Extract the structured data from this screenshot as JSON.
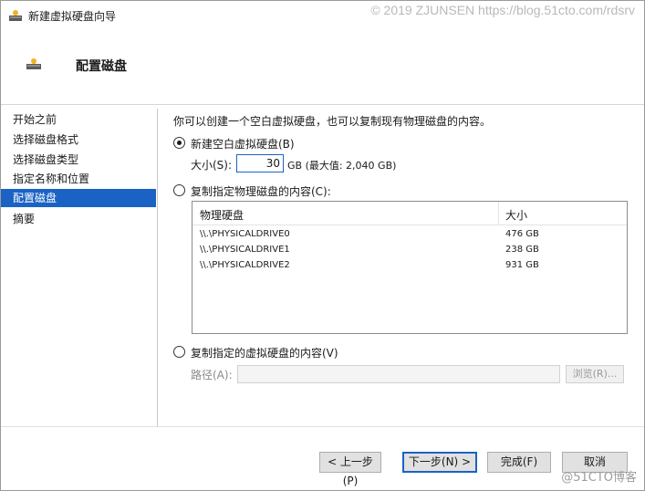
{
  "window": {
    "title": "新建虚拟硬盘向导",
    "watermark_top": "© 2019 ZJUNSEN https://blog.51cto.com/rdsrv",
    "watermark_bottom": "@51CTO博客"
  },
  "header": {
    "title": "配置磁盘"
  },
  "sidebar": {
    "items": [
      {
        "label": "开始之前",
        "active": false
      },
      {
        "label": "选择磁盘格式",
        "active": false
      },
      {
        "label": "选择磁盘类型",
        "active": false
      },
      {
        "label": "指定名称和位置",
        "active": false
      },
      {
        "label": "配置磁盘",
        "active": true
      },
      {
        "label": "摘要",
        "active": false
      }
    ]
  },
  "main": {
    "description": "你可以创建一个空白虚拟硬盘，也可以复制现有物理磁盘的内容。",
    "option_new": {
      "label": "新建空白虚拟硬盘(B)",
      "checked": true,
      "size_label": "大小(S):",
      "size_value": "30",
      "size_unit": "GB (最大值: 2,040 GB)"
    },
    "option_physical": {
      "label": "复制指定物理磁盘的内容(C):",
      "checked": false,
      "columns": [
        "物理硬盘",
        "大小"
      ],
      "rows": [
        {
          "disk": "\\\\.\\PHYSICALDRIVE0",
          "size": "476 GB"
        },
        {
          "disk": "\\\\.\\PHYSICALDRIVE1",
          "size": "238 GB"
        },
        {
          "disk": "\\\\.\\PHYSICALDRIVE2",
          "size": "931 GB"
        }
      ]
    },
    "option_virtual": {
      "label": "复制指定的虚拟硬盘的内容(V)",
      "checked": false,
      "path_label": "路径(A):",
      "path_value": "",
      "browse_label": "浏览(R)..."
    }
  },
  "footer": {
    "prev_label": "< 上一步(P)",
    "next_label": "下一步(N) >",
    "finish_label": "完成(F)",
    "cancel_label": "取消"
  },
  "colors": {
    "accent": "#1a63c4",
    "selection_bg": "#1a63c4"
  }
}
